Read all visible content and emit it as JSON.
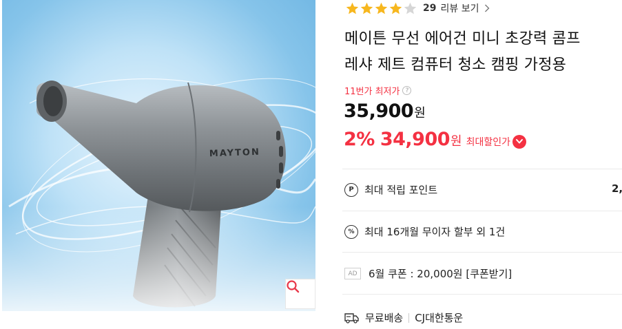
{
  "product": {
    "image_brand_text": "MAYTON",
    "rating": 4,
    "rating_max": 5,
    "review_count": "29",
    "review_link_label": "리뷰 보기",
    "title_line1": "메이튼 무선 에어건 미니 초강력 콤프",
    "title_line2": "레샤 제트 컴퓨터 청소 캠핑 가정용"
  },
  "price": {
    "lowest_label": "11번가 최저가",
    "help_glyph": "?",
    "original": "35,900",
    "original_unit": "원",
    "discount_rate": "2%",
    "sale": "34,900",
    "sale_unit": "원",
    "max_discount_label": "최대할인가"
  },
  "benefits": {
    "point_icon_glyph": "P",
    "point_label": "최대 적립 포인트",
    "point_value": "2,",
    "installment_icon_glyph": "%",
    "installment_label": "최대 16개월 무이자 할부 외 1건",
    "ad_badge": "AD",
    "coupon_label": "6월 쿠폰 : 20,000원 [쿠폰받기]"
  },
  "shipping": {
    "fee_label": "무료배송",
    "carrier": "CJ대한통운"
  },
  "colors": {
    "accent_red": "#f43142",
    "star_filled": "#f7b71e",
    "star_empty": "#d6d6d6"
  },
  "icons": {
    "zoom": "search-icon",
    "truck": "truck-icon",
    "heart": "heart-icon"
  }
}
